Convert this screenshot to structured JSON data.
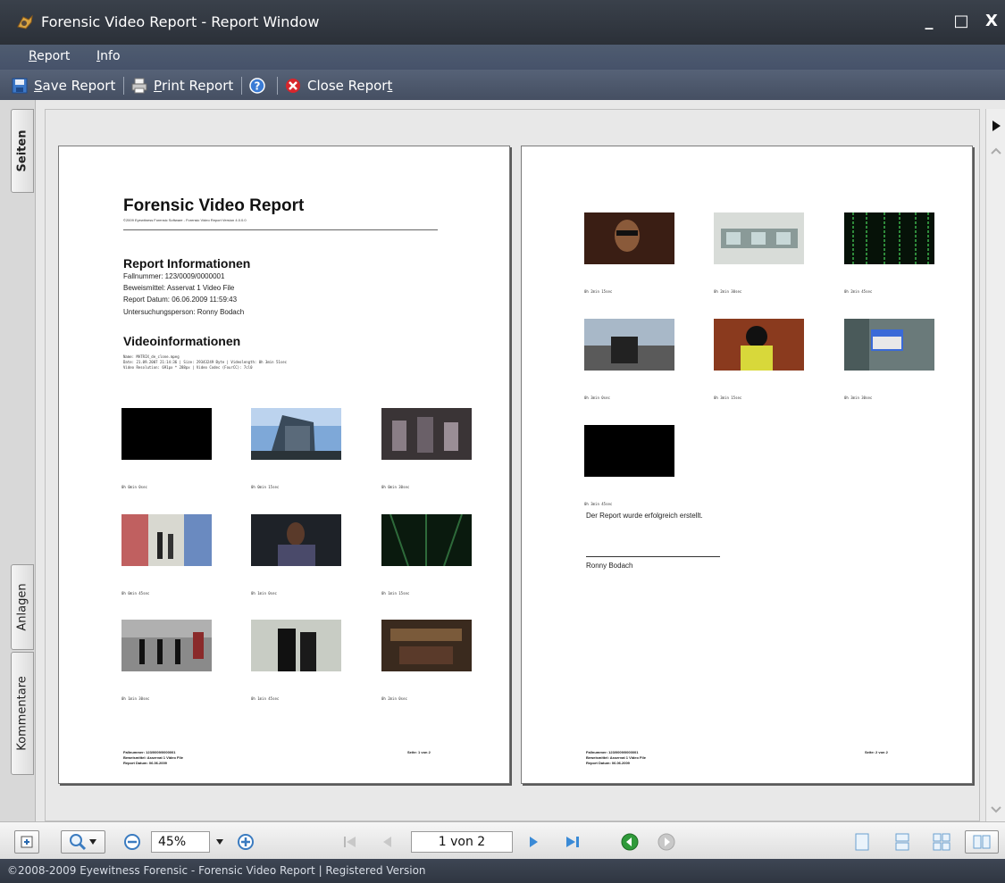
{
  "window": {
    "title": "Forensic Video Report - Report Window",
    "minimize": "_",
    "maximize": "□",
    "close": "X"
  },
  "menu": [
    {
      "mnemonic": "R",
      "rest": "eport"
    },
    {
      "mnemonic": "I",
      "rest": "nfo"
    }
  ],
  "toolbar": {
    "save": {
      "mnemonic": "S",
      "rest": "ave Report"
    },
    "print": {
      "mnemonic": "P",
      "rest": "rint Report"
    },
    "close": {
      "pre": "Close Repor",
      "mnemonic": "t"
    }
  },
  "side_tabs": {
    "pages": "Seiten",
    "attachments": "Anlagen",
    "comments": "Kommentare"
  },
  "report": {
    "title": "Forensic Video Report",
    "copyright": "©2009 Eyewitness Forensic Software - Forensic Video Report Version 4.0.0.0",
    "section1": "Report Informationen",
    "info_lines": [
      "Fallnummer: 123/0009/0000001",
      "Beweismittel: Asservat 1 Video File",
      "Report Datum: 06.06.2009 11:59:43",
      "Untersuchungsperson: Ronny Bodach"
    ],
    "section2": "Videoinformationen",
    "video_lines": [
      "Name: MATRIX_de_clone.mpeg",
      "Date: 21.09.2007 21:14:36 | Size: 29343249 Byte | Videolength: 0h 3min 51sec",
      "Video Resolution: 691px * 288px | Video Codec (FourCC): 7cl0"
    ],
    "thumb_captions_p1": [
      "0h 0min 0sec",
      "0h 0min 15sec",
      "0h 0min 30sec",
      "0h 0min 45sec",
      "0h 1min 0sec",
      "0h 1min 15sec",
      "0h 1min 30sec",
      "0h 1min 45sec",
      "0h 2min 0sec"
    ],
    "thumb_captions_p2": [
      "0h 2min 15sec",
      "0h 2min 30sec",
      "0h 2min 45sec",
      "0h 3min 0sec",
      "0h 3min 15sec",
      "0h 3min 30sec",
      "0h 3min 45sec"
    ],
    "footer_lines": [
      "Fallnummer: 123/0009/0000001",
      "Beweismittel: Asservat 1 Video File",
      "Report Datum: 06.06.2009"
    ],
    "page1_label": "Seite: 1 von 2",
    "page2_label": "Seite: 2 von 2",
    "success": "Der Report wurde erfolgreich erstellt.",
    "signer": "Ronny Bodach"
  },
  "bottom": {
    "zoom": "45%",
    "page": "1 von 2"
  },
  "status": "©2008-2009 Eyewitness Forensic - Forensic Video Report |  Registered Version",
  "colors": {
    "titlebar": "#2b3038",
    "toolbar": "#4f5c70",
    "statusbar": "#343b47",
    "accent_green": "#2f9a3a",
    "accent_blue": "#3a8ad6"
  },
  "icons": [
    "app-icon",
    "save-icon",
    "print-icon",
    "help-icon",
    "close-report-icon",
    "add-page-icon",
    "zoom-icon",
    "zoom-out-icon",
    "zoom-in-icon",
    "first-page-icon",
    "prev-page-icon",
    "next-page-icon",
    "last-page-icon",
    "back-icon",
    "forward-icon",
    "single-page-icon",
    "continuous-icon",
    "multi-page-icon",
    "facing-pages-icon"
  ]
}
